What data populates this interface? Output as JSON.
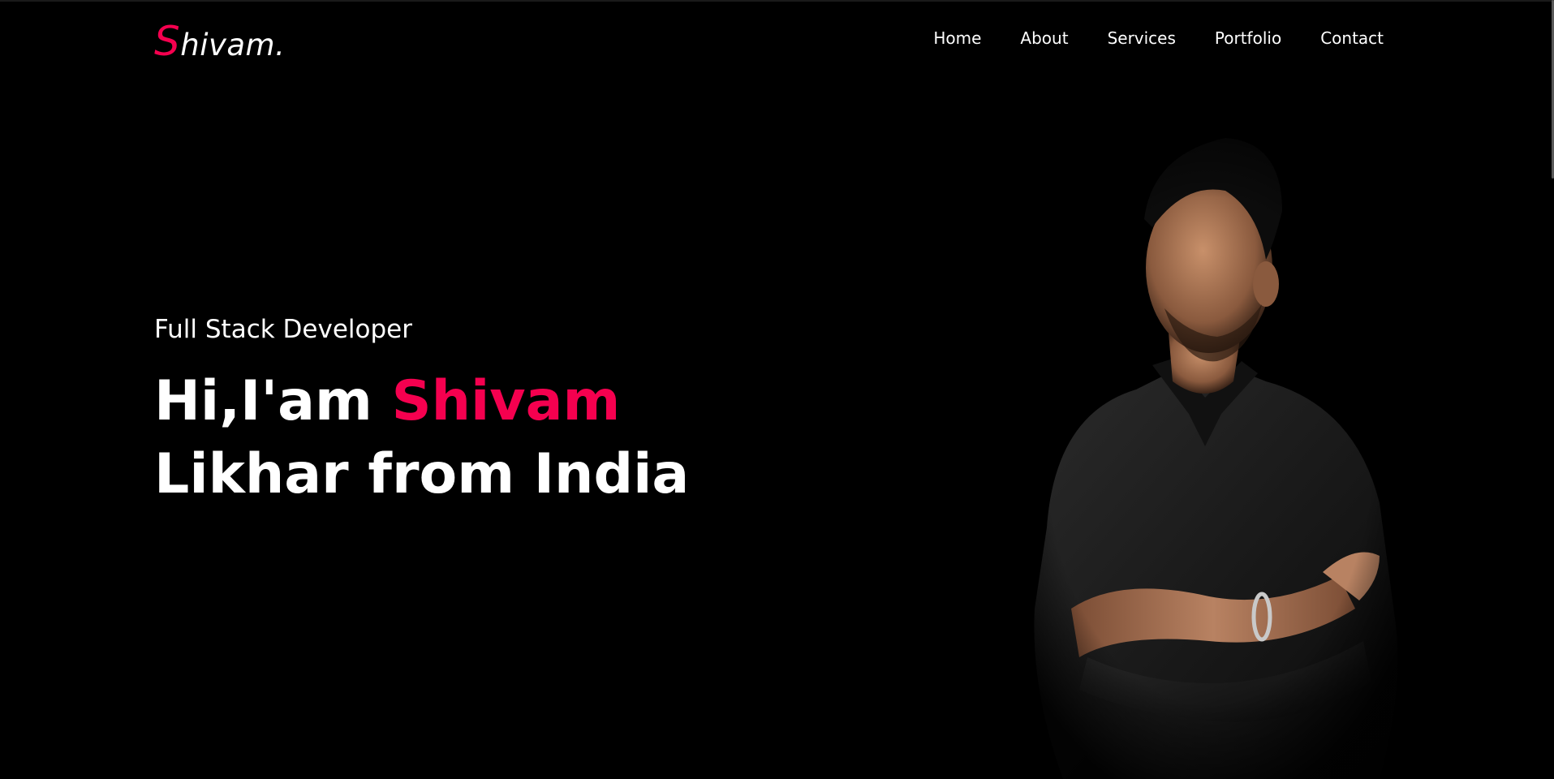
{
  "brand": {
    "first_letter": "S",
    "rest": "hivam.",
    "accent_color": "#f5004f"
  },
  "nav": {
    "items": [
      {
        "label": "Home"
      },
      {
        "label": "About"
      },
      {
        "label": "Services"
      },
      {
        "label": "Portfolio"
      },
      {
        "label": "Contact"
      }
    ]
  },
  "hero": {
    "subtitle": "Full Stack Developer",
    "greeting": "Hi,I'am ",
    "name_highlight": "Shivam",
    "line2": "Likhar from India"
  },
  "colors": {
    "background": "#000000",
    "text": "#ffffff",
    "accent": "#f5004f"
  }
}
